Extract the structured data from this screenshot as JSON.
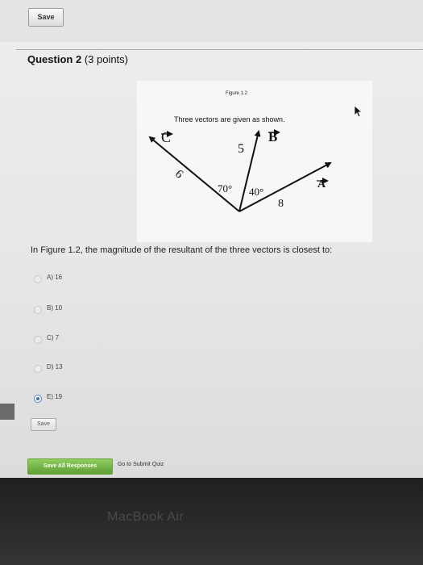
{
  "toolbar": {
    "save_label": "Save"
  },
  "question": {
    "number_label": "Question 2",
    "points": "(3 points)",
    "text": "In Figure 1.2, the magnitude of the resultant of the three vectors is closest to:"
  },
  "figure": {
    "label": "Figure 1.2",
    "caption": "Three vectors are given as shown.",
    "vector_c": "C",
    "vector_b": "B",
    "vector_a": "A",
    "mag_c": "6",
    "mag_b": "5",
    "mag_a": "8",
    "angle_left": "70°",
    "angle_right": "40°"
  },
  "options": [
    {
      "label": "A) 16",
      "selected": false
    },
    {
      "label": "B) 10",
      "selected": false
    },
    {
      "label": "C) 7",
      "selected": false
    },
    {
      "label": "D) 13",
      "selected": false
    },
    {
      "label": "E) 19",
      "selected": true
    }
  ],
  "footer": {
    "save_label": "Save",
    "save_all_label": "Save All Responses",
    "submit_label": "Go to Submit Quiz"
  },
  "device": {
    "brand": "MacBook Air"
  },
  "colors": {
    "accent": "#3b73bd",
    "save_all_green": "#6aa43a"
  }
}
